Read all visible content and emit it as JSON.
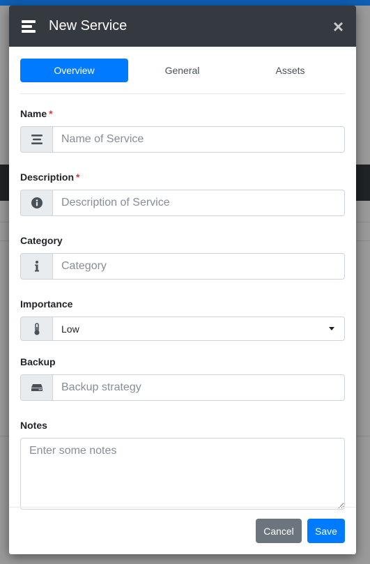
{
  "modal": {
    "title": "New Service",
    "tabs": [
      {
        "label": "Overview",
        "active": true
      },
      {
        "label": "General",
        "active": false
      },
      {
        "label": "Assets",
        "active": false
      }
    ]
  },
  "form": {
    "name": {
      "label": "Name",
      "required_mark": "*",
      "placeholder": "Name of Service",
      "icon": "align-left-icon"
    },
    "description": {
      "label": "Description",
      "required_mark": "*",
      "placeholder": "Description of Service",
      "icon": "info-circle-icon"
    },
    "category": {
      "label": "Category",
      "placeholder": "Category",
      "icon": "info-icon"
    },
    "importance": {
      "label": "Importance",
      "value": "Low",
      "icon": "thermometer-icon"
    },
    "backup": {
      "label": "Backup",
      "placeholder": "Backup strategy",
      "icon": "hdd-icon"
    },
    "notes": {
      "label": "Notes",
      "placeholder": "Enter some notes"
    }
  },
  "footer": {
    "cancel_label": "Cancel",
    "save_label": "Save"
  },
  "colors": {
    "header": "#343a40",
    "primary": "#007bff",
    "secondary": "#6c757d",
    "required": "#dc3545"
  }
}
